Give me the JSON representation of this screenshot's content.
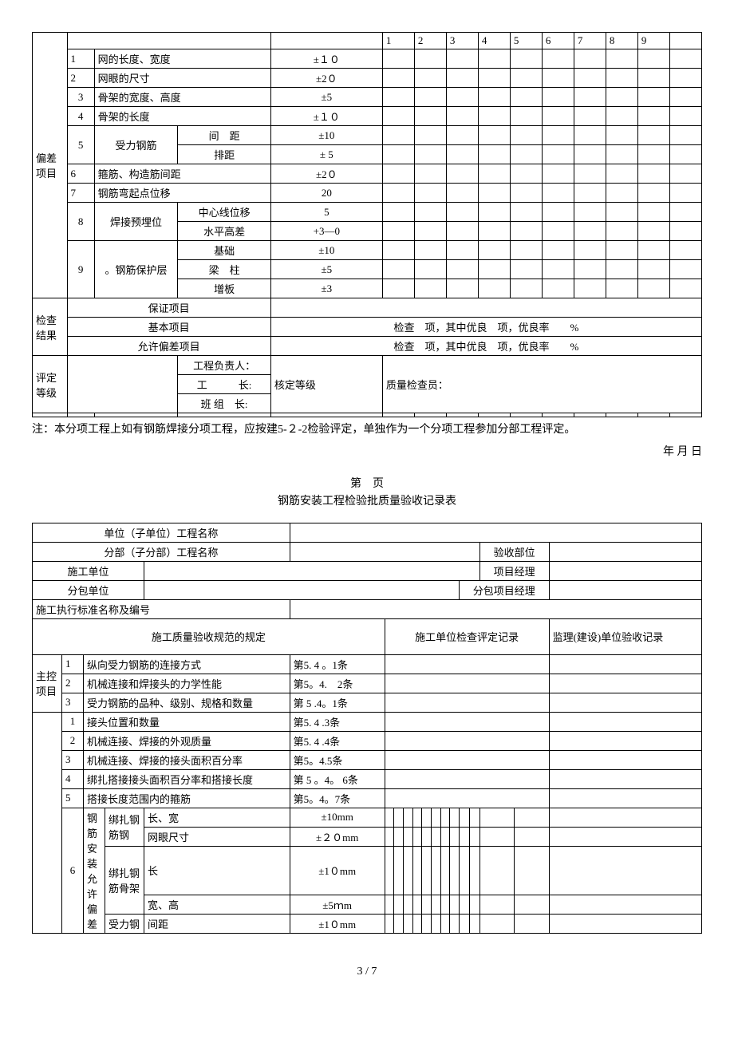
{
  "table1": {
    "section_label": "偏差项目",
    "header_nums": [
      "1",
      "2",
      "3",
      "4",
      "5",
      "6",
      "7",
      "8",
      "9"
    ],
    "rows": [
      {
        "n": "1",
        "name": "网的长度、宽度",
        "tol": "±１０"
      },
      {
        "n": "2",
        "name": "网眼的尺寸",
        "tol": "±2０"
      },
      {
        "n": "3",
        "name": "骨架的宽度、高度",
        "tol": "±5"
      },
      {
        "n": "4",
        "name": "骨架的长度",
        "tol": "±１０"
      }
    ],
    "row5": {
      "n": "5",
      "name": "受力钢筋",
      "sub1": "间　距",
      "tol1": "±10",
      "sub2": "排距",
      "tol2": "± 5"
    },
    "row6": {
      "n": "6",
      "name": "箍筋、构造筋间距",
      "tol": "±2０"
    },
    "row7": {
      "n": "7",
      "name": "钢筋弯起点位移",
      "tol": "20"
    },
    "row8": {
      "n": "8",
      "name": "焊接预埋位",
      "sub1": "中心线位移",
      "tol1": "5",
      "sub2": "水平高差",
      "tol2": "+3—0"
    },
    "row9": {
      "n": "9",
      "name": "。钢筋保护层",
      "sub1": "基础",
      "tol1": "±10",
      "sub2": "梁　柱",
      "tol2": "±5",
      "sub3": "增板",
      "tol3": "±3"
    },
    "check_label": "检查结果",
    "check_rows": {
      "r1": "保证项目",
      "r2": "基本项目",
      "r2v": "检查　项，其中优良　项，优良率　　%",
      "r3": "允许偏差项目",
      "r3v": "检查　项，其中优良　项，优良率　　%"
    },
    "eval_label": "评定等级",
    "eval_rows": {
      "r1": "工程负责人：",
      "r2": "工　　　长:",
      "r3": "班 组　长:",
      "side1": "核定等级",
      "side2": "质量检查员："
    }
  },
  "note_text": "注：本分项工程上如有钢筋焊接分项工程，应按建5-２-2检验评定，单独作为一个分项工程参加分部工程评定。",
  "date_text": "年  月  日",
  "page_header": "第　页",
  "form_title": "钢筋安装工程检验批质量验收记录表",
  "table2": {
    "labels": {
      "l1": "单位（子单位）工程名称",
      "l2": "分部（子分部）工程名称",
      "l2r": "验收部位",
      "l3": "施工单位",
      "l3r": "项目经理",
      "l4": "分包单位",
      "l4r": "分包项目经理",
      "l5": "施工执行标准名称及编号",
      "l6": "施工质量验收规范的规定",
      "l6r": "施工单位检查评定记录",
      "l6r2": "监理(建设)单位验收记录"
    },
    "zk_label": "主控项目",
    "zk_rows": [
      {
        "n": "1",
        "name": "纵向受力钢筋的连接方式",
        "ref": "第5. 4 。1条"
      },
      {
        "n": "2",
        "name": "机械连接和焊接头的力学性能",
        "ref": "第5。4.　2条"
      },
      {
        "n": "3",
        "name": "受力钢筋的品种、级别、规格和数量",
        "ref": "第 5 .4。1条"
      }
    ],
    "gen_rows": [
      {
        "n": "1",
        "name": "接头位置和数量",
        "ref": "第5. 4 .3条"
      },
      {
        "n": "2",
        "name": "机械连接、焊接的外观质量",
        "ref": "第5. 4 .4条"
      },
      {
        "n": "3",
        "name": "机械连接、焊接的接头面积百分率",
        "ref": "第5。4.5条"
      },
      {
        "n": "4",
        "name": "绑扎搭接接头面积百分率和搭接长度",
        "ref": "第 5 。4。 6条"
      },
      {
        "n": "5",
        "name": "搭接长度范围内的箍筋",
        "ref": "第5。4。7条"
      }
    ],
    "tol_section": {
      "n": "6",
      "vlabel": "钢筋安装允许偏差",
      "group1": "绑扎钢筋钢",
      "g1r1": {
        "name": "长、宽",
        "tol": "±10mm"
      },
      "g1r2": {
        "name": "网眼尺寸",
        "tol": "±２０mm"
      },
      "group2": "绑扎钢筋骨架",
      "g2r1": {
        "name": "长",
        "tol": "±1０mm"
      },
      "g2r2": {
        "name": "宽、高",
        "tol": "±5ｍm"
      },
      "group3": "受力钢",
      "g3r1": {
        "name": "间距",
        "tol": "±1０mm"
      }
    }
  },
  "footer": "3 / 7"
}
